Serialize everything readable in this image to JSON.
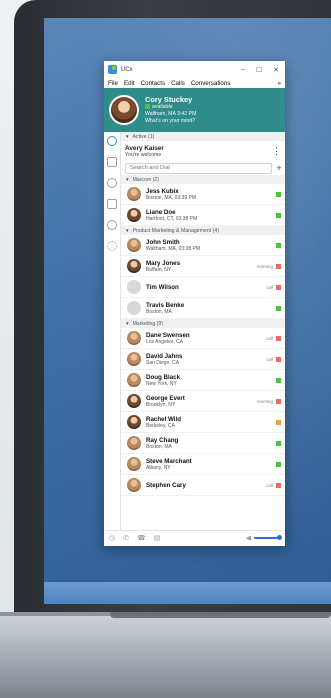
{
  "app": {
    "title": "UCx",
    "minimize": "–",
    "maximize": "☐",
    "close": "✕"
  },
  "menu": {
    "items": [
      "File",
      "Edit",
      "Contacts",
      "Calls",
      "Conversations"
    ],
    "more": "»"
  },
  "profile": {
    "name": "Cory Stuckey",
    "status": "available",
    "location": "Waltham, MA 3:42 PM",
    "mood": "What's on your mind?"
  },
  "active": {
    "header": "Active (1)",
    "name": "Avery Kaiser",
    "sub": "You're welcome"
  },
  "search": {
    "placeholder": "Search and Dial",
    "add": "+"
  },
  "groups": [
    {
      "header": "Marcom (2)",
      "contacts": [
        {
          "name": "Jess Kubix",
          "sub": "Boston, MA, 03:39 PM",
          "status": "",
          "presence": "green",
          "av": "alt"
        },
        {
          "name": "Liane Doe",
          "sub": "Hartford, CT, 03:38 PM",
          "status": "",
          "presence": "green",
          "av": ""
        }
      ]
    },
    {
      "header": "Product Marketing & Management (4)",
      "contacts": [
        {
          "name": "John Smith",
          "sub": "Waltham, MA, 03:38 PM",
          "status": "",
          "presence": "green",
          "av": "alt"
        },
        {
          "name": "Mary Jones",
          "sub": "Buffalo, NY",
          "status": "meeting",
          "presence": "red",
          "av": ""
        },
        {
          "name": "Tim Wilson",
          "sub": "",
          "status": "call",
          "presence": "red",
          "av": "blank"
        },
        {
          "name": "Travis Benke",
          "sub": "Boston, MA",
          "status": "",
          "presence": "green",
          "av": "blank"
        }
      ]
    },
    {
      "header": "Marketing (9)",
      "contacts": [
        {
          "name": "Dane Swensen",
          "sub": "Los Angeles, CA",
          "status": "call",
          "presence": "red",
          "av": "alt"
        },
        {
          "name": "David Jahns",
          "sub": "San Diego, CA",
          "status": "call",
          "presence": "red",
          "av": "alt"
        },
        {
          "name": "Doug Black",
          "sub": "New York, NY",
          "status": "",
          "presence": "green",
          "av": "alt"
        },
        {
          "name": "George Evert",
          "sub": "Brooklyn, NY",
          "status": "meeting",
          "presence": "red",
          "av": ""
        },
        {
          "name": "Rachel Wild",
          "sub": "Berkeley, CA",
          "status": "",
          "presence": "orange",
          "av": ""
        },
        {
          "name": "Ray Chang",
          "sub": "Boston, MA",
          "status": "",
          "presence": "green",
          "av": "alt"
        },
        {
          "name": "Steve Marchant",
          "sub": "Albany, NY",
          "status": "",
          "presence": "green",
          "av": "alt"
        },
        {
          "name": "Stephen Cary",
          "sub": "",
          "status": "call",
          "presence": "red",
          "av": "alt"
        }
      ]
    }
  ],
  "colors": {
    "header": "#2e8c8a",
    "presence_green": "#4cc13a",
    "presence_red": "#e66b6b",
    "presence_orange": "#f0a23a",
    "volume": "#2e6fd8"
  }
}
